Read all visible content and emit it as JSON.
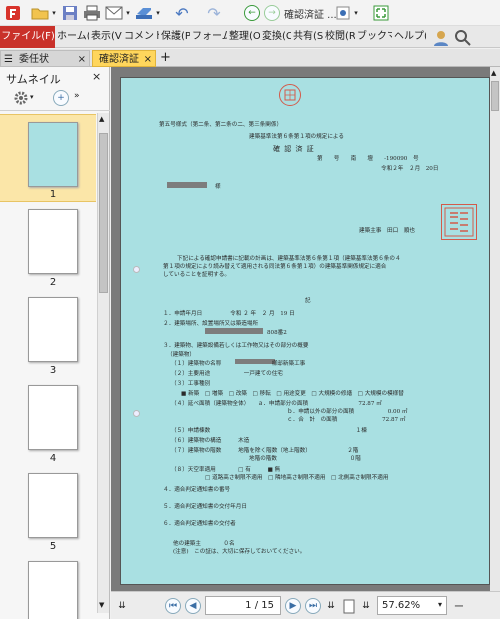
{
  "window": {
    "title": "確認済証 ..."
  },
  "ribbon": {
    "items": [
      "ファイル(F)",
      "ホーム(H",
      "表示(V",
      "コメント(C",
      "保護(P",
      "フォーム(F",
      "整理(O",
      "変換(C",
      "共有(S",
      "校閲(R",
      "ブックマー",
      "ヘルプ(H"
    ]
  },
  "tabs": [
    {
      "label": "委任状"
    },
    {
      "label": "確認済証"
    }
  ],
  "panel": {
    "title": "サムネイル",
    "close": "×"
  },
  "thumbnails": [
    {
      "label": "1"
    },
    {
      "label": "2"
    },
    {
      "label": "3"
    },
    {
      "label": "4"
    },
    {
      "label": "5"
    }
  ],
  "status": {
    "page": "1 / 15",
    "zoom": "57.62%"
  },
  "document": {
    "form_no": "第五号様式（第二条、第二条の二、第三条関係）",
    "law": "建築基準法第６条第１項の規定による",
    "title": "確 認 済 証",
    "number": "第　　号　　南　　壇　　-190090　号",
    "date": "令和２年　２月　20日",
    "addressee": "様",
    "issuer": "建築主事　田口　順也",
    "seal_text": "鈴本県建築主事",
    "body1": "下記による確認申請書に記載の計画は、建築基準法第６条第１項（建築基準法第６条の４",
    "body2": "第１項の規定により読み替えて適用される同法第６条第１項）の建築基準関係規定に適合",
    "body3": "していることを証明する。",
    "ki": "記",
    "items": [
      "１．申請年月日　　　　　令和 ２ 年　２ 月　19 日",
      "２．建築場所、設置場所又は築造場所",
      "３．建築物、建築設備若しくは工作物又はその部分の概要",
      "（建築物）",
      "（１）建築物の名称　　　　　　　　　様邸新築工事",
      "（２）主要用途　　　　　　一戸建ての住宅",
      "（３）工事種別",
      "■ 新築　□ 増築　□ 改築　□ 移転　□ 用途変更　□ 大規模の修繕　□ 大規模の模様替",
      "（４）延べ面積（建築物全体）　　ａ．申請部分の面積　　　　　　　　　72.87 ㎡",
      "ｂ．申請以外の部分の面積　　　　　　0.00 ㎡",
      "ｃ．合　計　の面積　　　　　　　　72.87 ㎡",
      "（５）申請棟数　　　　　　　　　　　　　　　　　　　　　　　　　　１棟",
      "（６）建築物の構造　　　木造",
      "（７）建築物の階数　　　地階を除く階数（地上階数）　　　　　　　２階",
      "地階の階数　　　　　　　　　　　　　０階",
      "（８）天空率適用　　　　□ 有　　　■ 無",
      "□ 道路高さ制限不適用　□ 隣地高さ制限不適用　□ 北側高さ制限不適用",
      "４．適合判定通知書の番号",
      "５．適合判定通知書の交付年月日",
      "６．適合判定通知書の交付者",
      "他の建築主　　　　０名",
      "(注意)　この証は、大切に保存しておいてください。"
    ],
    "lot": "808番2"
  }
}
